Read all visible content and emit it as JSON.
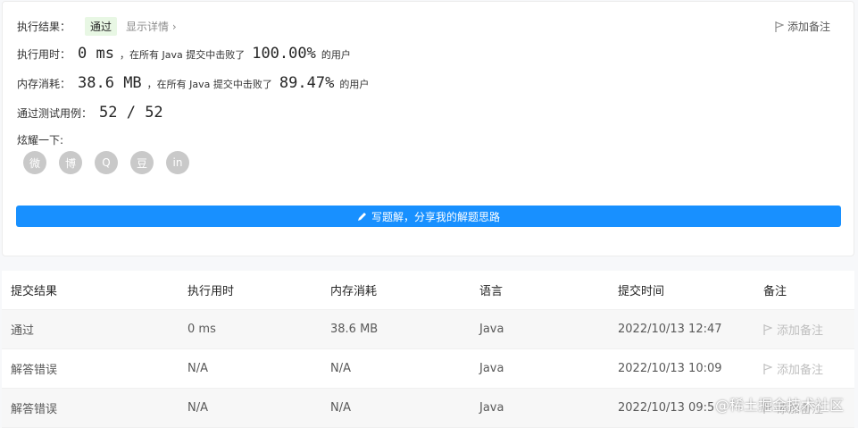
{
  "result": {
    "label": "执行结果：",
    "status": "通过",
    "detail_link": "显示详情 ›",
    "add_note": "添加备注"
  },
  "runtime": {
    "label": "执行用时：",
    "value": "0 ms",
    "mid_text": "，在所有 Java 提交中击败了",
    "percent": "100.00%",
    "suffix": "的用户"
  },
  "memory": {
    "label": "内存消耗：",
    "value": "38.6 MB",
    "mid_text": "，在所有 Java 提交中击败了",
    "percent": "89.47%",
    "suffix": "的用户"
  },
  "tests": {
    "label": "通过测试用例：",
    "value": "52 / 52"
  },
  "share": {
    "label": "炫耀一下:",
    "icons": [
      "wechat-icon",
      "weibo-icon",
      "qq-icon",
      "douban-icon",
      "linkedin-icon"
    ],
    "glyphs": [
      "微",
      "博",
      "Q",
      "豆",
      "in"
    ]
  },
  "cta": {
    "label": "写题解，分享我的解题思路"
  },
  "table": {
    "headers": [
      "提交结果",
      "执行用时",
      "内存消耗",
      "语言",
      "提交时间",
      "备注"
    ],
    "rows": [
      {
        "result": "通过",
        "time": "0 ms",
        "memory": "38.6 MB",
        "lang": "Java",
        "submitted": "2022/10/13 12:47",
        "note": "添加备注"
      },
      {
        "result": "解答错误",
        "time": "N/A",
        "memory": "N/A",
        "lang": "Java",
        "submitted": "2022/10/13 10:09",
        "note": "添加备注"
      },
      {
        "result": "解答错误",
        "time": "N/A",
        "memory": "N/A",
        "lang": "Java",
        "submitted": "2022/10/13 09:5",
        "note": "添加备注"
      }
    ]
  },
  "watermark": "@稀土掘金技术社区",
  "colors": {
    "accent": "#1890ff",
    "success": "#2db55d",
    "error": "#ef4743"
  }
}
